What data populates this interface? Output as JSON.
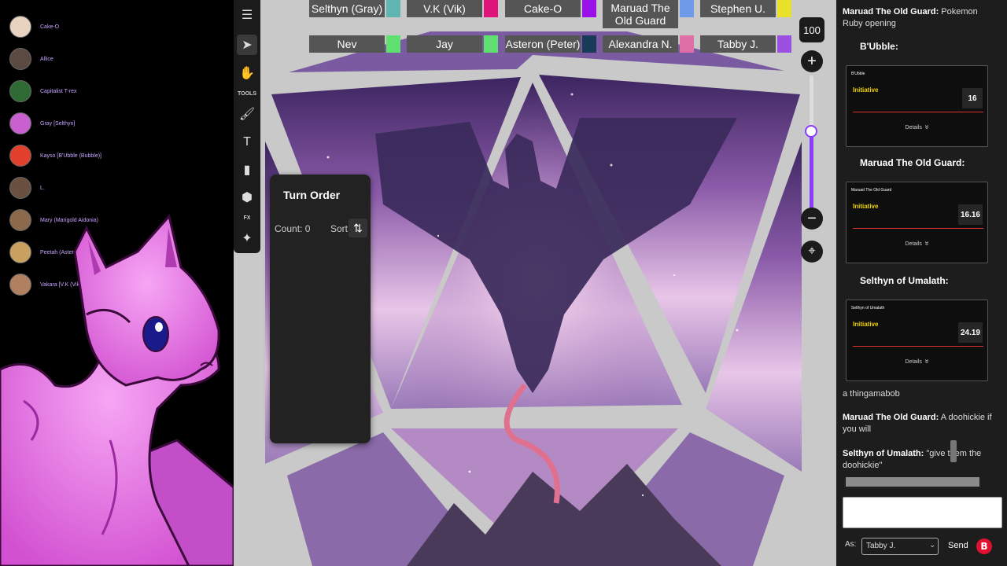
{
  "viewers": [
    {
      "name": "Cake-O",
      "color": "#e8d2c0"
    },
    {
      "name": "Allice",
      "color": "#5a4a42"
    },
    {
      "name": "Capitalist T-rex",
      "color": "#2e6b34"
    },
    {
      "name": "Gray [Selthyn]",
      "color": "#c860d0"
    },
    {
      "name": "Kayso [B'Ubble (Bubble)]",
      "color": "#e0402c"
    },
    {
      "name": "L.",
      "color": "#6a5040"
    },
    {
      "name": "Mary (Marigold Aidonia)",
      "color": "#8a6a4a"
    },
    {
      "name": "Peetah (Asteron)",
      "color": "#c8a060"
    },
    {
      "name": "Vakara [V.K (Vik)]",
      "color": "#b08060"
    }
  ],
  "players_row1": [
    {
      "name": "Selthyn (Gray)",
      "color": "#5fb5b0"
    },
    {
      "name": "V.K (Vik)",
      "color": "#e0137a"
    },
    {
      "name": "Cake-O",
      "color": "#9a10e8"
    },
    {
      "name": "Maruad The Old Guard",
      "color": "#6f9ae8"
    },
    {
      "name": "Stephen U.",
      "color": "#e8e02a"
    }
  ],
  "players_row2": [
    {
      "name": "Nev",
      "color": "#5fe070"
    },
    {
      "name": "Jay",
      "color": "#60e070"
    },
    {
      "name": "Asteron (Peter)",
      "color": "#1a3a5a"
    },
    {
      "name": "Alexandra N.",
      "color": "#e070a8"
    },
    {
      "name": "Tabby J.",
      "color": "#9a50e0"
    }
  ],
  "toolbar": {
    "tools_label": "TOOLS",
    "fx_label": "FX"
  },
  "turn_order": {
    "title": "Turn Order",
    "count": "Count: 0",
    "sort": "Sort"
  },
  "zoom": {
    "value": "100",
    "level": 0.58
  },
  "chat": {
    "msg1_author": "Maruad The Old Guard:",
    "msg1_text": "Pokemon Ruby opening",
    "rolls": [
      {
        "header": "B'Ubble:",
        "card_name": "B'Ubble",
        "label": "Initiative",
        "value": "16",
        "details": "Details"
      },
      {
        "header": "Maruad The Old Guard:",
        "card_name": "Maruad The Old Guard",
        "label": "Initiative",
        "value": "16.16",
        "details": "Details"
      },
      {
        "header": "Selthyn of Umalath:",
        "card_name": "Selthyn of Umalath",
        "label": "Initiative",
        "value": "24.19",
        "details": "Details"
      }
    ],
    "msg2_text": "a thingamabob",
    "msg3_author": "Maruad The Old Guard:",
    "msg3_text": "A doohickie if you will",
    "msg4_author": "Selthyn of Umalath:",
    "msg4_text": "\"give them the doohickie\"",
    "as_label": "As:",
    "as_value": "Tabby J.",
    "send_label": "Send",
    "brand_letter": "B"
  },
  "colors": {
    "accent": "#8a3cff",
    "panel": "#1d1d1d",
    "initiative": "#f2d300",
    "roll_line": "#e03030"
  }
}
